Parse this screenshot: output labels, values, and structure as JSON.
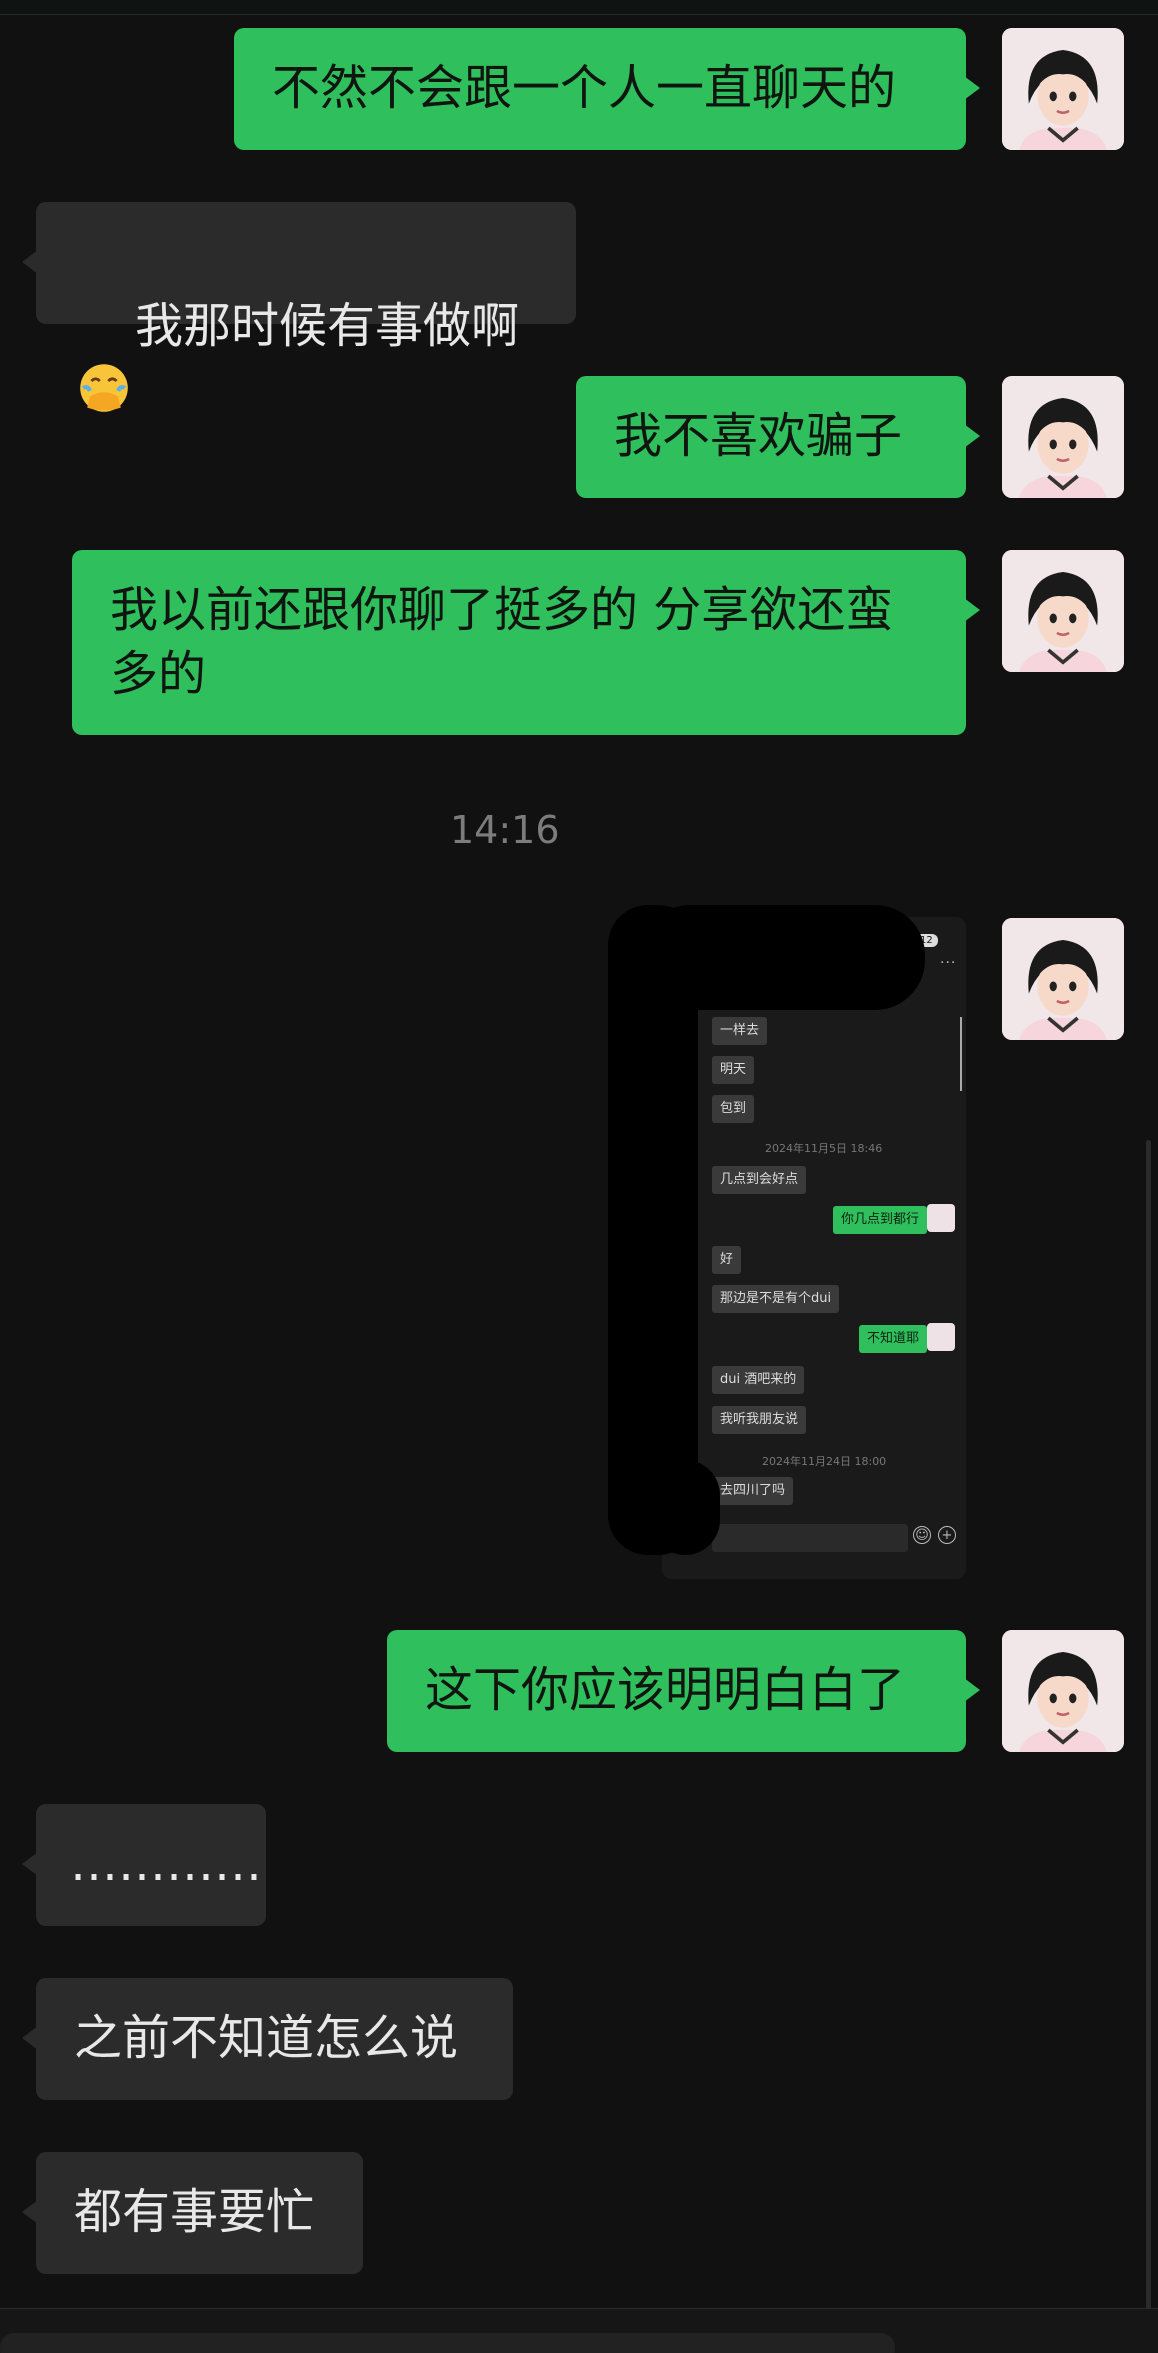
{
  "messages": [
    {
      "side": "me",
      "text": "不然不会跟一个人一直聊天的"
    },
    {
      "side": "them",
      "text": "我那时候有事做啊",
      "emoji": "face-with-hand-over-mouth-emoji"
    },
    {
      "side": "me",
      "text": "我不喜欢骗子"
    },
    {
      "side": "me",
      "text": "我以前还跟你聊了挺多的 分享欲还蛮\n多的"
    },
    {
      "side": "me",
      "text": "这下你应该明明白白了"
    },
    {
      "side": "them",
      "text": "…………"
    },
    {
      "side": "them",
      "text": "之前不知道怎么说"
    },
    {
      "side": "them",
      "text": "都有事要忙"
    }
  ],
  "timestamp": "14:16",
  "shared_screenshot": {
    "badge": "12",
    "dots": "...",
    "items": [
      {
        "side": "them",
        "text": "一样去"
      },
      {
        "side": "them",
        "text": "明天"
      },
      {
        "side": "them",
        "text": "包到"
      },
      {
        "side": "time",
        "text": "2024年11月5日 18:46"
      },
      {
        "side": "them",
        "text": "几点到会好点"
      },
      {
        "side": "me",
        "text": "你几点到都行"
      },
      {
        "side": "them",
        "text": "好"
      },
      {
        "side": "them",
        "text": "那边是不是有个dui"
      },
      {
        "side": "me",
        "text": "不知道耶"
      },
      {
        "side": "them",
        "text": "dui 酒吧来的"
      },
      {
        "side": "them",
        "text": "我听我朋友说"
      },
      {
        "side": "time",
        "text": "2024年11月24日 18:00"
      },
      {
        "side": "them",
        "text": "去四川了吗"
      }
    ]
  },
  "colors": {
    "background": "#111111",
    "sent_bubble": "#2fbf5c",
    "received_bubble": "#2b2b2b",
    "timestamp": "#7c7c7c"
  }
}
